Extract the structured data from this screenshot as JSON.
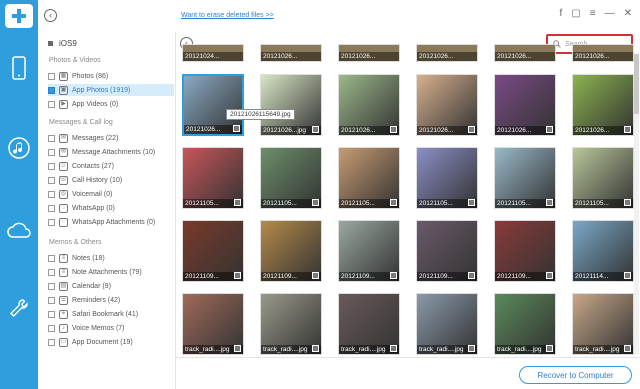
{
  "rail": {
    "logo": "plus-logo",
    "items": [
      {
        "name": "phone-icon",
        "active": false
      },
      {
        "name": "music-note-icon",
        "active": true
      },
      {
        "name": "cloud-icon",
        "active": false
      },
      {
        "name": "wrench-icon",
        "active": false
      }
    ]
  },
  "topbar": {
    "erase_link": "Want to erase deleted files >>",
    "window_controls": [
      "f",
      "▢",
      "≡",
      "—",
      "✕"
    ]
  },
  "sidebar": {
    "device": "iOS9",
    "sections": [
      {
        "title": "Photos & Videos",
        "items": [
          {
            "label": "Photos (86)",
            "icon": "photo-icon",
            "checked": false,
            "selected": false
          },
          {
            "label": "App Photos (1919)",
            "icon": "app-photo-icon",
            "checked": true,
            "selected": true
          },
          {
            "label": "App Videos (0)",
            "icon": "video-icon",
            "checked": false,
            "selected": false
          }
        ]
      },
      {
        "title": "Messages & Call log",
        "items": [
          {
            "label": "Messages (22)",
            "icon": "message-icon",
            "checked": false,
            "selected": false
          },
          {
            "label": "Message Attachments (10)",
            "icon": "attachment-icon",
            "checked": false,
            "selected": false
          },
          {
            "label": "Contacts (27)",
            "icon": "contacts-icon",
            "checked": false,
            "selected": false
          },
          {
            "label": "Call History (10)",
            "icon": "call-icon",
            "checked": false,
            "selected": false
          },
          {
            "label": "Voicemail (0)",
            "icon": "voicemail-icon",
            "checked": false,
            "selected": false
          },
          {
            "label": "WhatsApp (0)",
            "icon": "whatsapp-icon",
            "checked": false,
            "selected": false
          },
          {
            "label": "WhatsApp Attachments (0)",
            "icon": "whatsapp-attach-icon",
            "checked": false,
            "selected": false
          }
        ]
      },
      {
        "title": "Memos & Others",
        "items": [
          {
            "label": "Notes (18)",
            "icon": "notes-icon",
            "checked": false,
            "selected": false
          },
          {
            "label": "Note Attachments (79)",
            "icon": "note-attach-icon",
            "checked": false,
            "selected": false
          },
          {
            "label": "Calendar (9)",
            "icon": "calendar-icon",
            "checked": false,
            "selected": false
          },
          {
            "label": "Reminders (42)",
            "icon": "reminder-icon",
            "checked": false,
            "selected": false
          },
          {
            "label": "Safari Bookmark (41)",
            "icon": "bookmark-icon",
            "checked": false,
            "selected": false
          },
          {
            "label": "Voice Memos (7)",
            "icon": "voice-memo-icon",
            "checked": false,
            "selected": false
          },
          {
            "label": "App Document (19)",
            "icon": "document-icon",
            "checked": false,
            "selected": false
          }
        ]
      }
    ]
  },
  "content": {
    "search_placeholder": "Search",
    "tooltip": "20121026115649.jpg",
    "top_row_labels": [
      "20121024...",
      "20121026...",
      "20121026...",
      "20121026...",
      "20121026...",
      "20121026..."
    ],
    "rows": [
      [
        {
          "label": "20121026...",
          "color": "#8aa9c4",
          "selected": true
        },
        {
          "label": "20121026...jpg",
          "color": "#d9e6c5"
        },
        {
          "label": "20121026...",
          "color": "#9bb88a"
        },
        {
          "label": "20121026...",
          "color": "#d7b08e"
        },
        {
          "label": "20121026...",
          "color": "#7a4a86"
        },
        {
          "label": "20121026...",
          "color": "#8bb350"
        }
      ],
      [
        {
          "label": "20121105...",
          "color": "#c8555a"
        },
        {
          "label": "20121105...",
          "color": "#6d8f6a"
        },
        {
          "label": "20121105...",
          "color": "#c79b72"
        },
        {
          "label": "20121105...",
          "color": "#8a8fc6"
        },
        {
          "label": "20121105...",
          "color": "#9ab9c9"
        },
        {
          "label": "20121105...",
          "color": "#b9c79a"
        }
      ],
      [
        {
          "label": "20121109...",
          "color": "#7a3a2a"
        },
        {
          "label": "20121109...",
          "color": "#b58a4a"
        },
        {
          "label": "20121109...",
          "color": "#9aa8a0"
        },
        {
          "label": "20121109...",
          "color": "#6a5a6a"
        },
        {
          "label": "20121109...",
          "color": "#8a3a3a"
        },
        {
          "label": "20121114...",
          "color": "#7aa8c8"
        }
      ],
      [
        {
          "label": "track_radi....jpg",
          "color": "#a06a5a"
        },
        {
          "label": "track_radi....jpg",
          "color": "#9a9a8a"
        },
        {
          "label": "track_radi....jpg",
          "color": "#6a5a5a"
        },
        {
          "label": "track_radi....jpg",
          "color": "#8a9aaa"
        },
        {
          "label": "track_radi....jpg",
          "color": "#5a8a5a"
        },
        {
          "label": "track_radi....jpg",
          "color": "#c8a88a"
        }
      ]
    ]
  },
  "footer": {
    "recover_label": "Recover to Computer"
  },
  "colors": {
    "accent": "#2e9fdc",
    "search_border": "#cc3333",
    "link": "#2e7fd0"
  }
}
